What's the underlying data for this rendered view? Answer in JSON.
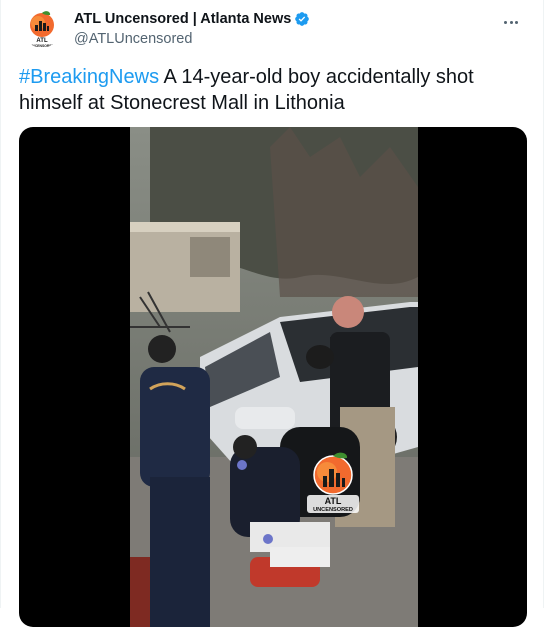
{
  "author": {
    "display_name": "ATL Uncensored | Atlanta News",
    "handle": "@ATLUncensored",
    "verified": true,
    "avatar_text": "ATL UNCENSORED"
  },
  "tweet": {
    "hashtag": "#BreakingNews",
    "text": " A 14-year-old boy accidentally shot himself at Stonecrest Mall in Lithonia"
  },
  "media": {
    "watermark_text": "ATL UNCENSORED"
  },
  "colors": {
    "link": "#1d9bf0",
    "text": "#0f1419",
    "secondary": "#536471"
  },
  "icons": {
    "more": "more-icon",
    "verified": "verified-badge-icon"
  }
}
